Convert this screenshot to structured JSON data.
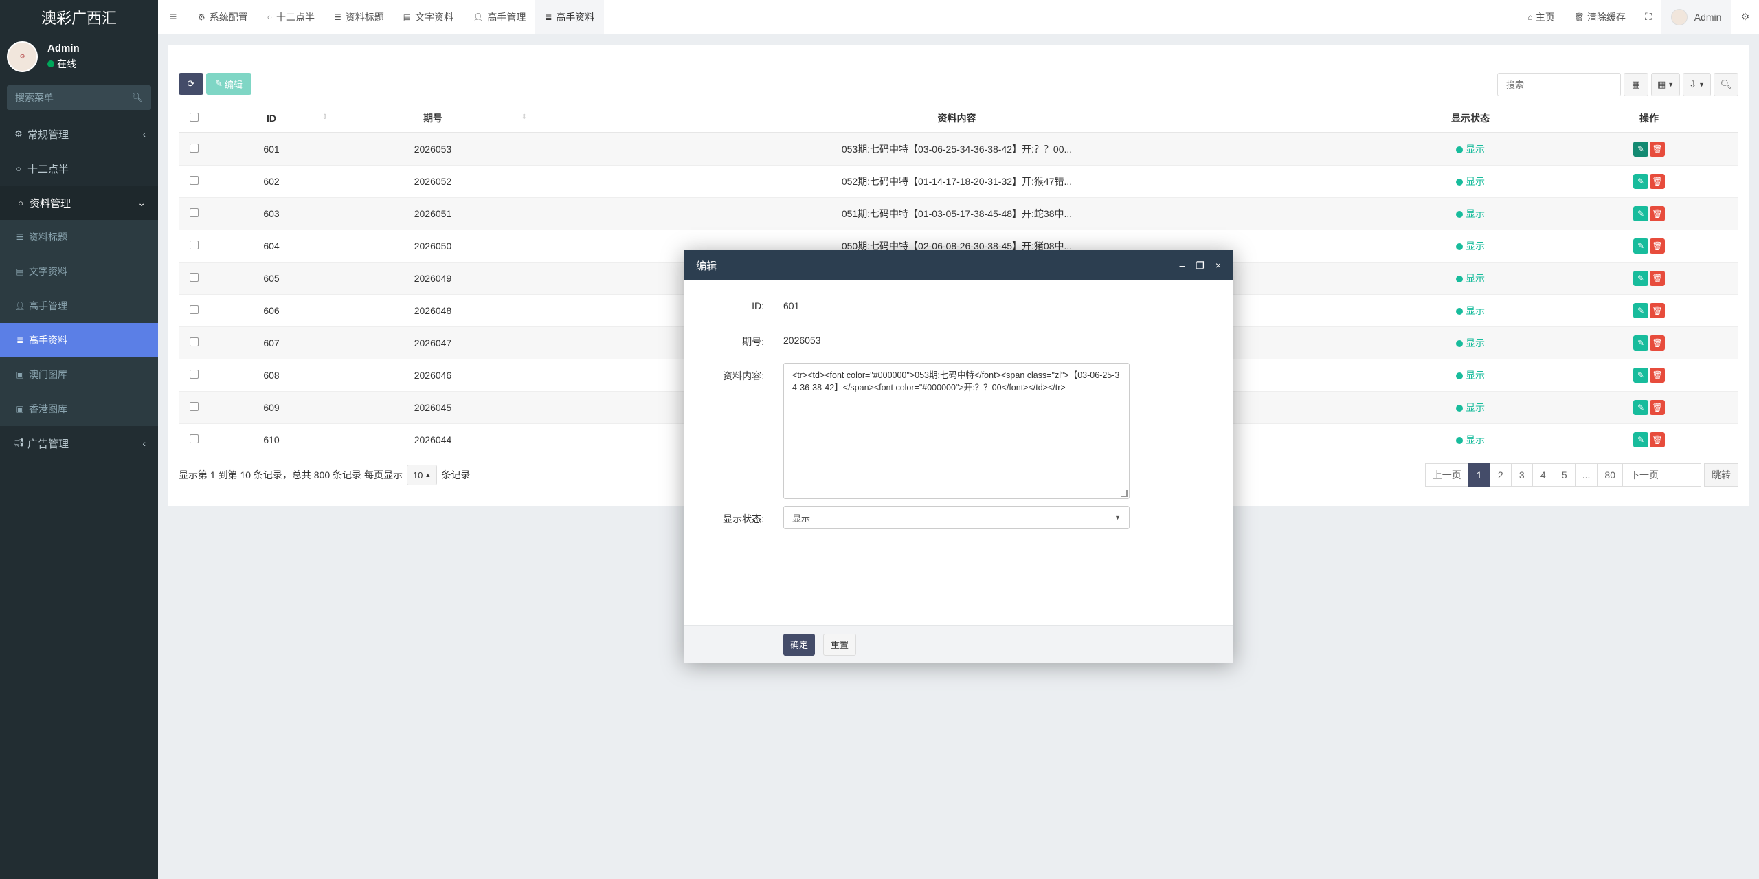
{
  "app": {
    "brand": "澳彩广西汇"
  },
  "user": {
    "name": "Admin",
    "status": "在线"
  },
  "sidebar": {
    "search_placeholder": "搜索菜单",
    "menu": [
      {
        "label": "常规管理",
        "icon": "gears-icon"
      },
      {
        "label": "十二点半",
        "icon": "circle-icon"
      },
      {
        "label": "资料管理",
        "icon": "circle-icon"
      }
    ],
    "sub_items": [
      {
        "label": "资料标题",
        "icon": "list-icon"
      },
      {
        "label": "文字资料",
        "icon": "file-icon"
      },
      {
        "label": "高手管理",
        "icon": "user-icon"
      },
      {
        "label": "高手资料",
        "icon": "database-icon"
      },
      {
        "label": "澳门图库",
        "icon": "image-icon"
      },
      {
        "label": "香港图库",
        "icon": "image-icon"
      }
    ],
    "ads": {
      "label": "广告管理",
      "icon": "bullhorn-icon"
    }
  },
  "topnav": {
    "tabs": [
      {
        "label": "系统配置",
        "icon": "gear-icon"
      },
      {
        "label": "十二点半",
        "icon": "circle-icon"
      },
      {
        "label": "资料标题",
        "icon": "list-icon"
      },
      {
        "label": "文字资料",
        "icon": "file-icon"
      },
      {
        "label": "高手管理",
        "icon": "user-icon"
      },
      {
        "label": "高手资料",
        "icon": "database-icon"
      }
    ],
    "home": "主页",
    "clear_cache": "清除缓存",
    "user": "Admin"
  },
  "toolbar": {
    "edit_label": "编辑",
    "search_placeholder": "搜索"
  },
  "table": {
    "headers": {
      "id": "ID",
      "issue": "期号",
      "content": "资料内容",
      "status": "显示状态",
      "ops": "操作"
    },
    "rows": [
      {
        "id": "601",
        "issue": "2026053",
        "content": "053期:七码中特【03-06-25-34-36-38-42】开:？？00...",
        "status": "显示"
      },
      {
        "id": "602",
        "issue": "2026052",
        "content": "052期:七码中特【01-14-17-18-20-31-32】开:猴47错...",
        "status": "显示"
      },
      {
        "id": "603",
        "issue": "2026051",
        "content": "051期:七码中特【01-03-05-17-38-45-48】开:蛇38中...",
        "status": "显示"
      },
      {
        "id": "604",
        "issue": "2026050",
        "content": "050期:七码中特【02-06-08-26-30-38-45】开:猪08中...",
        "status": "显示"
      },
      {
        "id": "605",
        "issue": "2026049",
        "content": "",
        "status": "显示"
      },
      {
        "id": "606",
        "issue": "2026048",
        "content": "",
        "status": "显示"
      },
      {
        "id": "607",
        "issue": "2026047",
        "content": "",
        "status": "显示"
      },
      {
        "id": "608",
        "issue": "2026046",
        "content": "",
        "status": "显示"
      },
      {
        "id": "609",
        "issue": "2026045",
        "content": "",
        "status": "显示"
      },
      {
        "id": "610",
        "issue": "2026044",
        "content": "",
        "status": "显示"
      }
    ]
  },
  "pager": {
    "info_prefix": "显示第 1 到第 10 条记录，总共 800 条记录 每页显示",
    "page_size": "10",
    "info_suffix": "条记录",
    "prev": "上一页",
    "pages": [
      "1",
      "2",
      "3",
      "4",
      "5",
      "...",
      "80"
    ],
    "next": "下一页",
    "jump": "跳转"
  },
  "modal": {
    "title": "编辑",
    "labels": {
      "id": "ID:",
      "issue": "期号:",
      "content": "资料内容:",
      "status": "显示状态:"
    },
    "values": {
      "id": "601",
      "issue": "2026053",
      "content": "<tr><td><font color=\"#000000\">053期:七码中特</font><span class=\"zl\">【03-06-25-34-36-38-42】</span><font color=\"#000000\">开:？？00</font></td></tr>",
      "status": "显示"
    },
    "ok": "确定",
    "reset": "重置"
  },
  "colors": {
    "sidebar_bg": "#222d32",
    "active_menu": "#5b7fe6",
    "primary": "#444c69",
    "success": "#18bc9c",
    "danger": "#e74c3c",
    "modal_head": "#2c3e50"
  }
}
